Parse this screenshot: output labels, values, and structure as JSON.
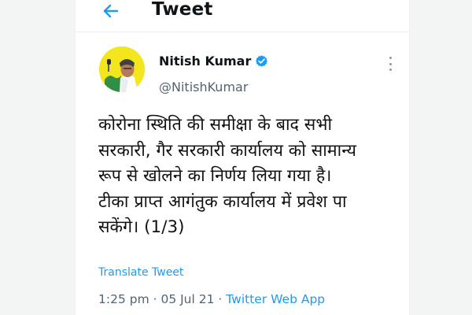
{
  "header": {
    "title": "Tweet"
  },
  "author": {
    "name": "Nitish Kumar",
    "handle": "@NitishKumar",
    "verified": true,
    "avatar_bg": "#f3e61c"
  },
  "tweet": {
    "lines": [
      "कोरोना स्थिति की समीक्षा के बाद सभी",
      "सरकारी, गैर सरकारी कार्यालय को सामान्य",
      "रूप से खोलने का निर्णय लिया गया है।",
      "टीका प्राप्त आगंतुक कार्यालय में प्रवेश पा",
      "सकेंगे। (1/3)"
    ],
    "translate_label": "Translate Tweet"
  },
  "meta": {
    "time": "1:25 pm",
    "separator": " · ",
    "date": "05 Jul 21",
    "source": "Twitter Web App"
  },
  "colors": {
    "accent": "#1d9bf0",
    "muted": "#536471",
    "text": "#0f1419"
  },
  "icons": {
    "back": "back-arrow-icon",
    "verified": "verified-badge-icon",
    "more": "more-options-icon"
  }
}
